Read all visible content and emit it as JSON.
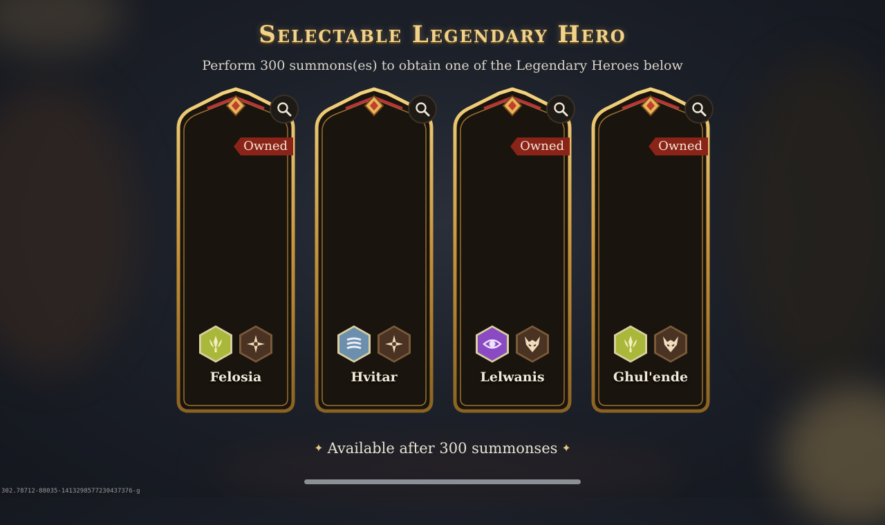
{
  "header": {
    "title": "Selectable Legendary Hero",
    "subtitle": "Perform 300 summons(es) to obtain one of the Legendary Heroes below"
  },
  "heroes": [
    {
      "name": "Felosia",
      "owned_label": "Owned",
      "is_owned": true,
      "affinity_icon": "nature-emblem-icon",
      "role_icon": "compass-star-icon",
      "affinity_color": "#a9b83a",
      "portrait_palette": {
        "hair": "#ece6c8",
        "skin": "#f0d4c2",
        "outfit": "#2f5a2a",
        "accent": "#3a7fc4"
      }
    },
    {
      "name": "Hvitar",
      "owned_label": "",
      "is_owned": false,
      "affinity_icon": "wind-waves-icon",
      "role_icon": "compass-star-icon",
      "affinity_color": "#6d8fae",
      "portrait_palette": {
        "hair": "#c9d7ea",
        "skin": "#8fa6c8",
        "outfit": "#36385a",
        "accent": "#7aa6d8"
      }
    },
    {
      "name": "Lelwanis",
      "owned_label": "Owned",
      "is_owned": true,
      "affinity_icon": "eye-emblem-icon",
      "role_icon": "demon-mask-icon",
      "affinity_color": "#8a4bc2",
      "portrait_palette": {
        "hair": "#d8d0d4",
        "skin": "#b8a09a",
        "outfit": "#3a1e34",
        "accent": "#c03a5a"
      }
    },
    {
      "name": "Ghul'ende",
      "owned_label": "Owned",
      "is_owned": true,
      "affinity_icon": "nature-emblem-icon",
      "role_icon": "demon-mask-icon",
      "affinity_color": "#a9b83a",
      "portrait_palette": {
        "hair": "#b8306a",
        "skin": "#6e5a78",
        "outfit": "#4a4452",
        "accent": "#d04a8a"
      }
    }
  ],
  "footer": {
    "available_text": "Available after 300 summonses",
    "star_glyph": "✦",
    "debug_id": "302.78712-88035-1413298577230437376-g"
  },
  "colors": {
    "gold": "#d8a945",
    "title_gold": "#f0d28a",
    "owned_badge": "#8a2418",
    "role_icon_bg": "#4a3322"
  }
}
